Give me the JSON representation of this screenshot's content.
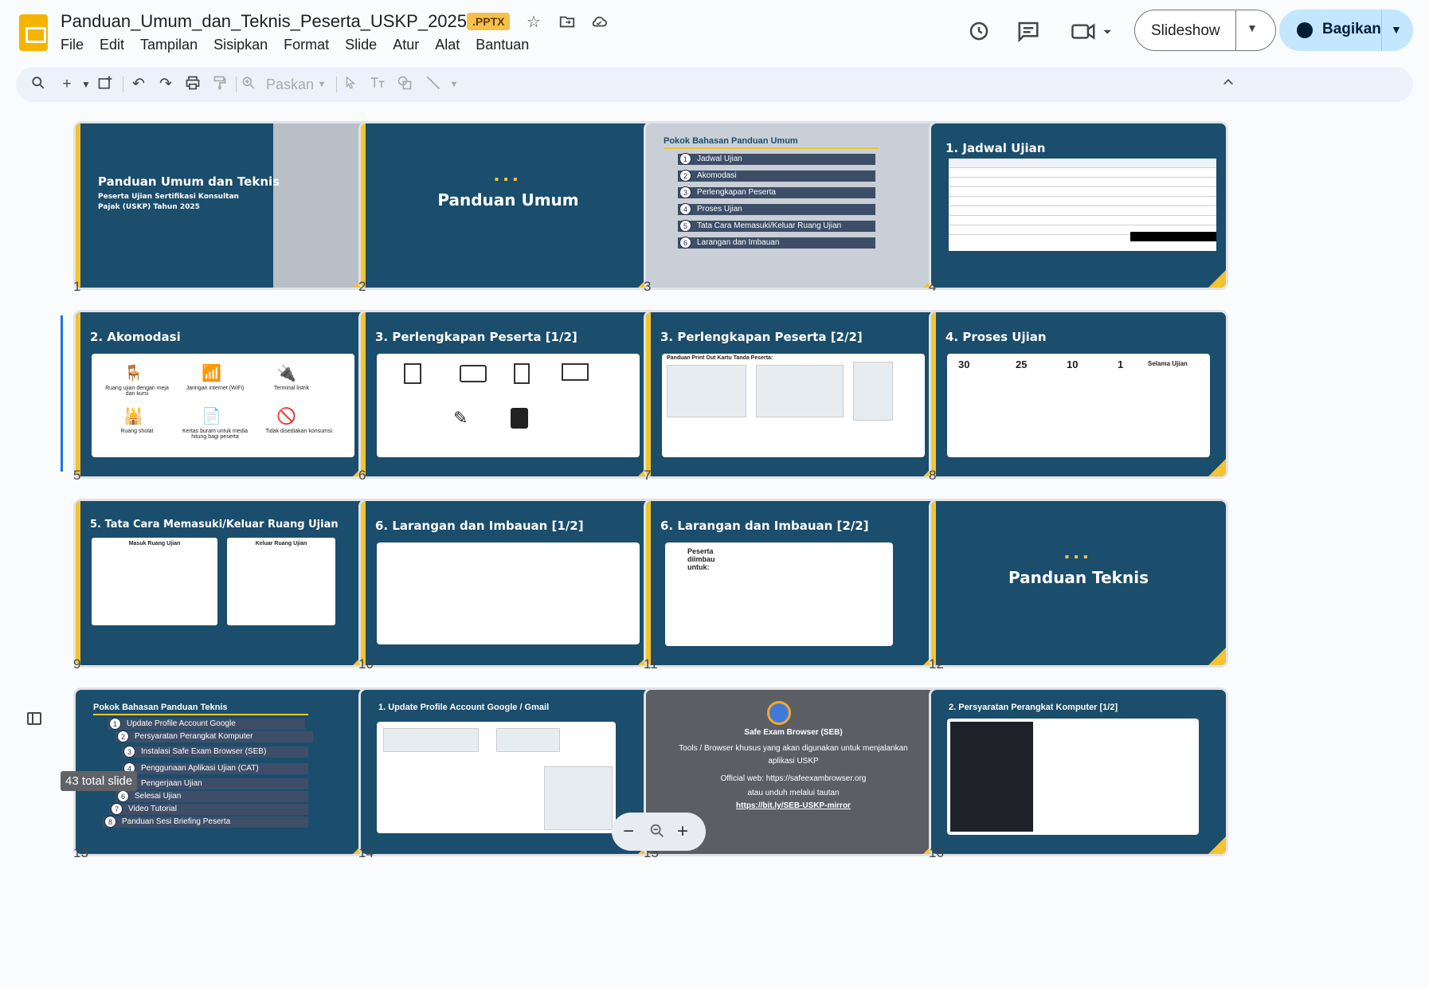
{
  "app": {
    "doc_title": "Panduan_Umum_dan_Teknis_Peserta_USKP_2025",
    "doc_badge": ".PPTX",
    "menu": [
      "File",
      "Edit",
      "Tampilan",
      "Sisipkan",
      "Format",
      "Slide",
      "Atur",
      "Alat",
      "Bantuan"
    ],
    "slideshow_label": "Slideshow",
    "share_label": "Bagikan",
    "zoom_label": "Paskan",
    "colors": {
      "share_bg": "#c2e7ff",
      "slide_dark": "#1b4d6c",
      "accent_yellow": "#f4c430"
    }
  },
  "slides": [
    {
      "number": "1",
      "title": "Panduan Umum dan Teknis",
      "subtitle": "Peserta Ujian Sertifikasi Konsultan Pajak (USKP) Tahun 2025"
    },
    {
      "number": "2",
      "title": "Panduan Umum"
    },
    {
      "number": "3",
      "title": "Pokok Bahasan Panduan Umum",
      "items": [
        "Jadwal Ujian",
        "Akomodasi",
        "Perlengkapan Peserta",
        "Proses Ujian",
        "Tata Cara Memasuki/Keluar Ruang Ujian",
        "Larangan dan Imbauan"
      ]
    },
    {
      "number": "4",
      "title": "1. Jadwal Ujian"
    },
    {
      "number": "5",
      "title": "2. Akomodasi",
      "items": [
        "Ruang ujian dengan meja dan kursi",
        "Jaringan internet (WiFi)",
        "Terminal listrik",
        "Ruang sholat",
        "Kertas buram untuk media hitung bagi peserta",
        "Tidak disediakan konsumsi."
      ]
    },
    {
      "number": "6",
      "title": "3. Perlengkapan Peserta [1/2]"
    },
    {
      "number": "7",
      "title": "3. Perlengkapan Peserta [2/2]",
      "caption": "Panduan Print Out Kartu Tanda Peserta:"
    },
    {
      "number": "8",
      "title": "4. Proses Ujian",
      "stats": [
        "30",
        "25",
        "10",
        "1",
        "Selama Ujian"
      ]
    },
    {
      "number": "9",
      "title": "5. Tata Cara Memasuki/Keluar Ruang Ujian",
      "cols": [
        "Masuk Ruang Ujian",
        "Keluar Ruang Ujian"
      ]
    },
    {
      "number": "10",
      "title": "6. Larangan dan Imbauan [1/2]"
    },
    {
      "number": "11",
      "title": "6. Larangan dan Imbauan [2/2]",
      "caption": "Peserta diimbau untuk:"
    },
    {
      "number": "12",
      "title": "Panduan Teknis"
    },
    {
      "number": "13",
      "title": "Pokok Bahasan Panduan Teknis",
      "items": [
        "Update Profile Account Google",
        "Persyaratan Perangkat Komputer",
        "Instalasi Safe Exam Browser (SEB)",
        "Penggunaan Aplikasi Ujian (CAT)",
        "Pengerjaan Ujian",
        "Selesai Ujian",
        "Video Tutorial",
        "Panduan Sesi Briefing Peserta"
      ]
    },
    {
      "number": "14",
      "title": "1. Update Profile Account Google / Gmail"
    },
    {
      "number": "15",
      "title": "Safe Exam Browser (SEB)",
      "line1": "Tools / Browser khusus yang akan digunakan untuk menjalankan aplikasi USKP",
      "line2": "Official web: https://safeexambrowser.org",
      "line3": "atau unduh melalui tautan",
      "line4": "https://bit.ly/SEB-USKP-mirror"
    },
    {
      "number": "16",
      "title": "2. Persyaratan Perangkat Komputer [1/2]"
    }
  ],
  "tooltip": "43 total slide"
}
